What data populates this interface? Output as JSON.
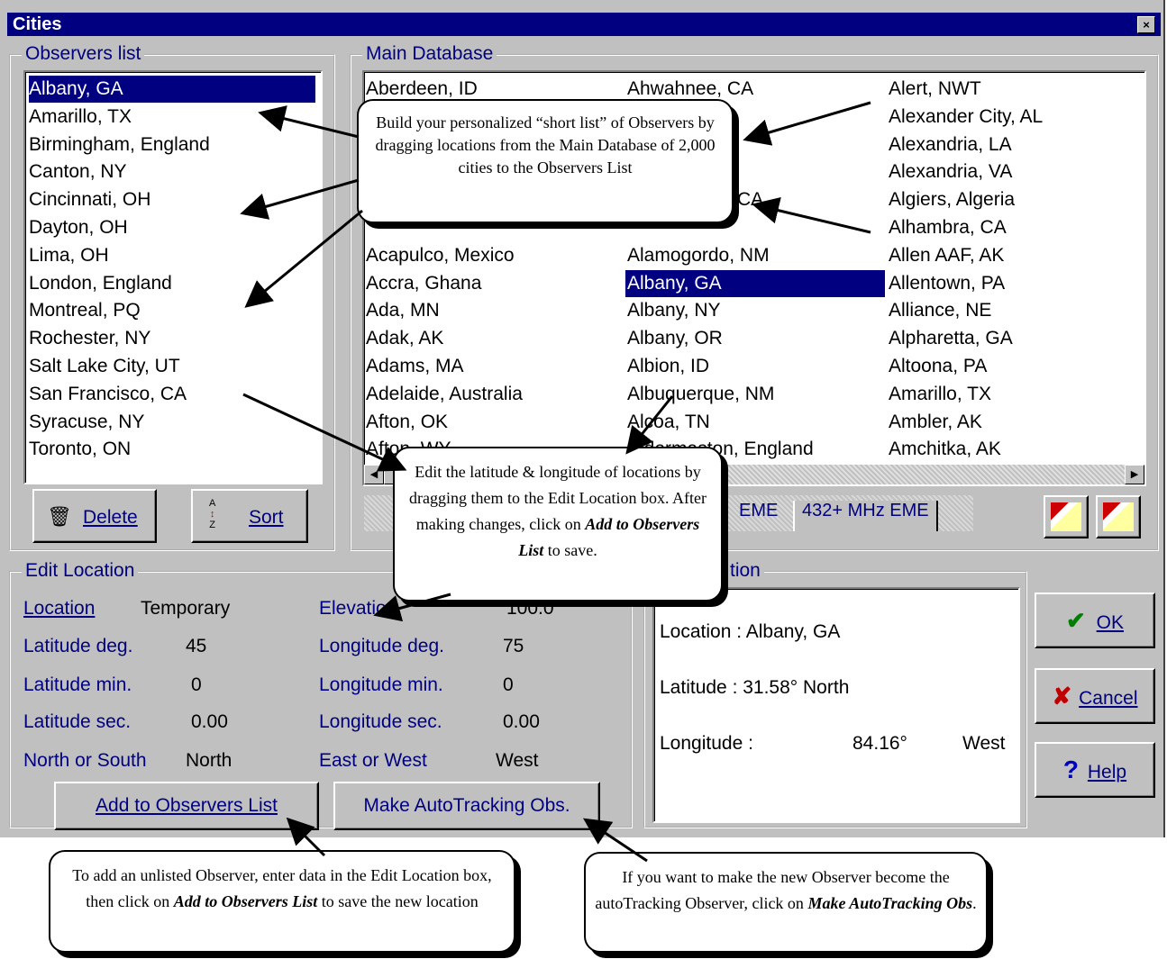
{
  "window": {
    "title": "Cities",
    "close": "×"
  },
  "observers": {
    "label": "Observers list",
    "items": [
      "Albany, GA",
      "Amarillo, TX",
      "Birmingham, England",
      "Canton, NY",
      "Cincinnati, OH",
      "Dayton, OH",
      "Lima, OH",
      "London, England",
      "Montreal, PQ",
      "Rochester, NY",
      "Salt Lake City, UT",
      "San Francisco, CA",
      "Syracuse, NY",
      "Toronto, ON"
    ],
    "delete_label": "Delete",
    "sort_label": "Sort"
  },
  "database": {
    "label": "Main Database",
    "col1": [
      "Aberdeen, ID",
      "",
      "",
      "",
      "",
      "",
      "Acapulco, Mexico",
      "Accra, Ghana",
      "Ada, MN",
      "Adak, AK",
      "Adams, MA",
      "Adelaide, Australia",
      "Afton, OK",
      "Afton, WY"
    ],
    "col2": [
      "Ahwahnee, CA",
      "",
      "",
      "",
      "",
      "",
      "Alamogordo, NM",
      "Albany, GA",
      "Albany, NY",
      "Albany, OR",
      "Albion, ID",
      "Albuquerque, NM",
      "Alcoa, TN",
      "Aldermaston, England"
    ],
    "col3": [
      "Alert, NWT",
      "Alexander City, AL",
      "Alexandria, LA",
      "Alexandria, VA",
      "Algiers, Algeria",
      "Alhambra, CA",
      "Allen AAF, AK",
      "Allentown, PA",
      "Alliance, NE",
      "Alpharetta, GA",
      "Altoona, PA",
      "Amarillo, TX",
      "Ambler, AK",
      "Amchitka, AK"
    ],
    "partial_ca": "CA",
    "tabs": [
      "EME",
      "432+ MHz EME"
    ]
  },
  "edit": {
    "label": "Edit Location",
    "location_label": "Location",
    "location_value": "Temporary",
    "lat_deg_label": "Latitude deg.",
    "lat_deg": "45",
    "lat_min_label": "Latitude min.",
    "lat_min": "0",
    "lat_sec_label": "Latitude sec.",
    "lat_sec": "0.00",
    "ns_label": "North or South",
    "ns": "North",
    "elev_label": "Elevation",
    "elev": "100.0",
    "lon_deg_label": "Longitude deg.",
    "lon_deg": "75",
    "lon_min_label": "Longitude min.",
    "lon_min": "0",
    "lon_sec_label": "Longitude sec.",
    "lon_sec": "0.00",
    "ew_label": "East or West",
    "ew": "West",
    "add_btn": "Add to Observers List",
    "make_btn": "Make AutoTracking Obs."
  },
  "info": {
    "label_tail": "tion",
    "location": "Location : Albany, GA",
    "latitude": "Latitude :  31.58°  North",
    "longitude_label": "Longitude :",
    "longitude_value": "84.16°",
    "longitude_dir": "West"
  },
  "buttons": {
    "ok": "OK",
    "cancel": "Cancel",
    "help": "Help"
  },
  "callouts": {
    "c1": "Build your personalized “short list” of Observers by dragging locations from the Main Database of 2,000 cities to the Observers List",
    "c2_a": "Edit the latitude & longitude of locations by  dragging them to the Edit Location box.  After making changes, click on ",
    "c2_b": "Add to Observers List",
    "c2_c": " to save.",
    "c3_a": "To add an unlisted Observer, enter data in the Edit Location box, then click on ",
    "c3_b": "Add to Observers List",
    "c3_c": " to save the new location",
    "c4_a": "If you want to make the new Observer become the autoTracking Observer, click on ",
    "c4_b": "Make AutoTracking Obs",
    "c4_c": "."
  }
}
